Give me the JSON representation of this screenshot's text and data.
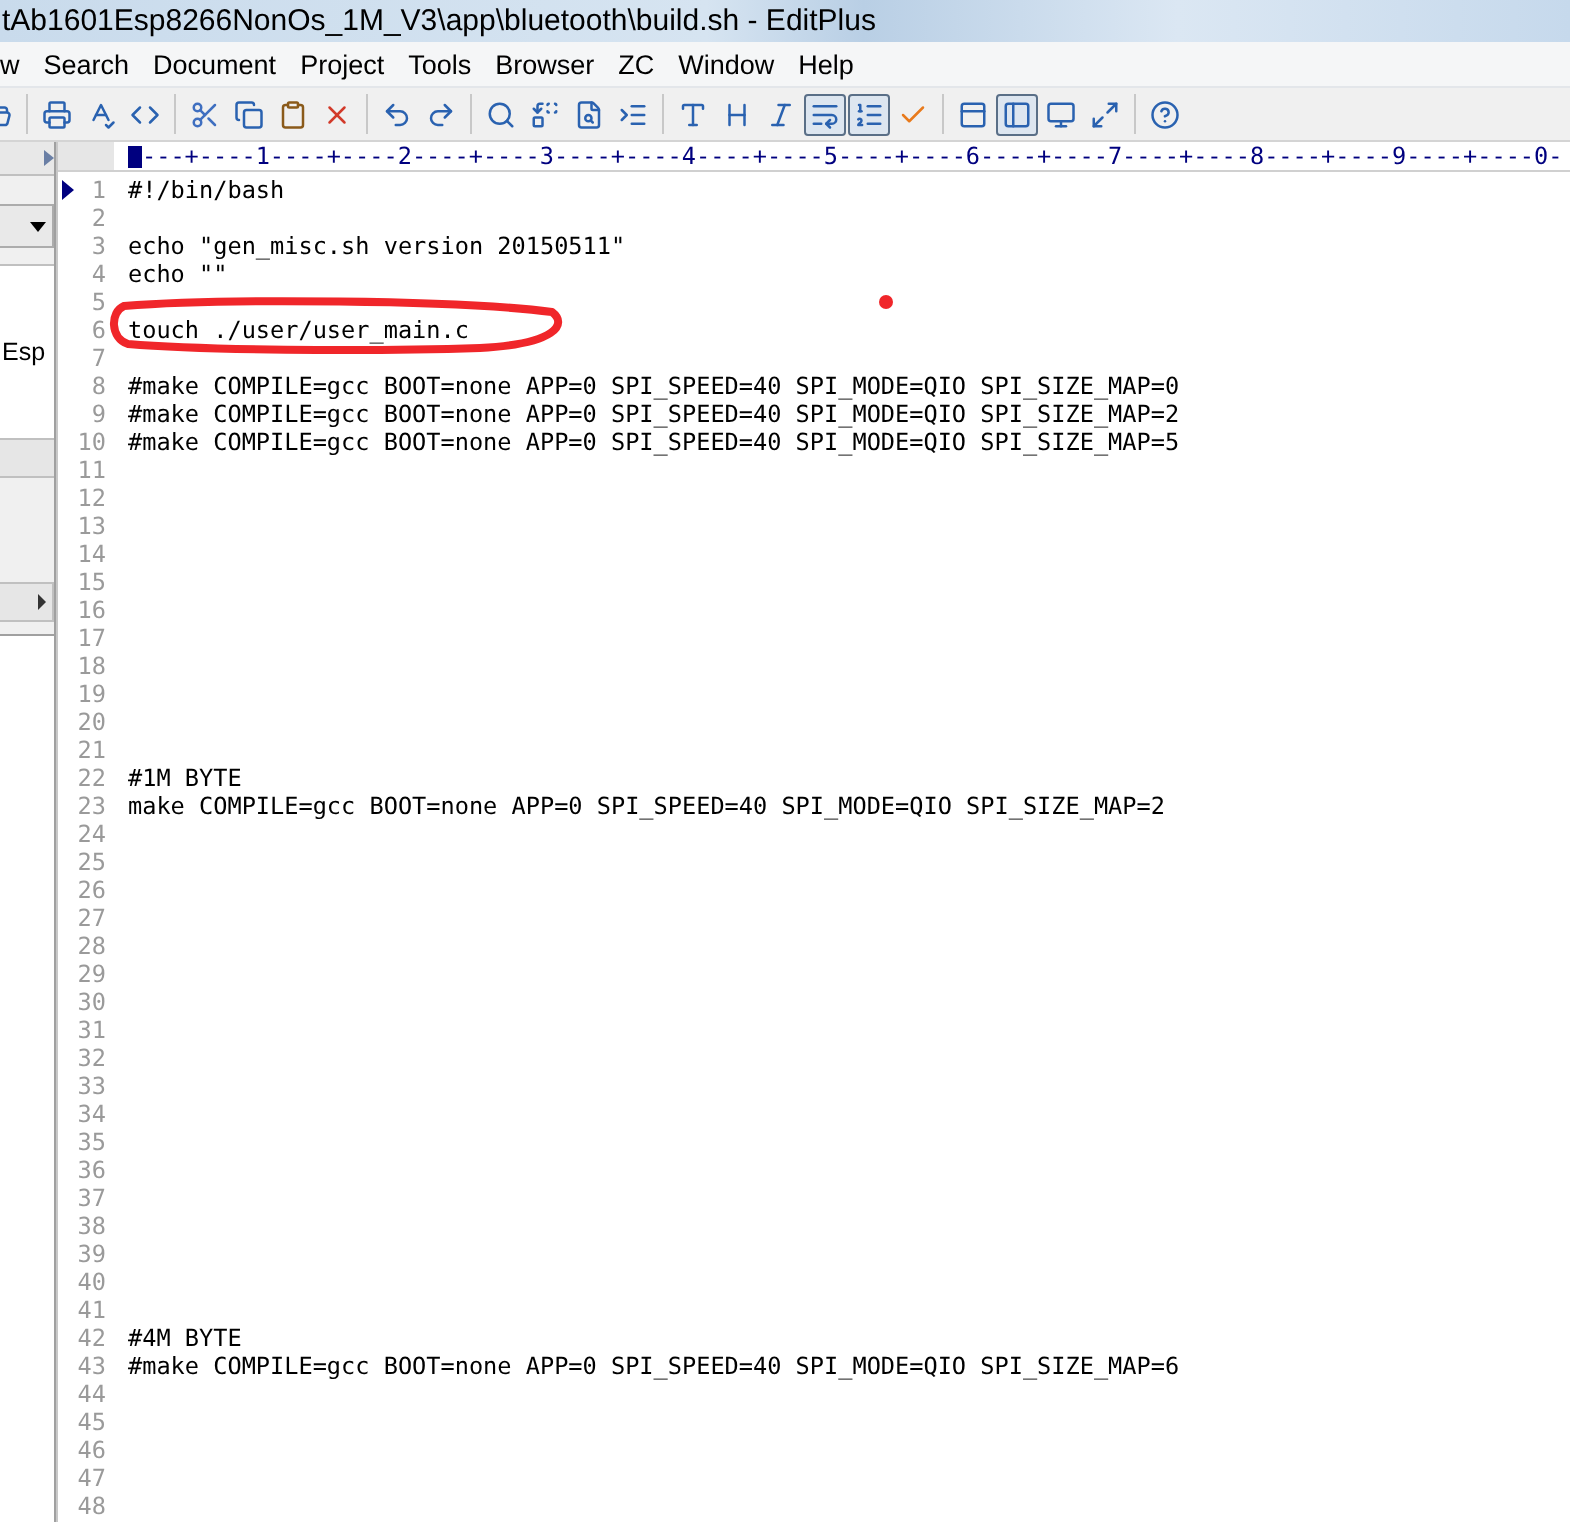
{
  "window": {
    "title": "tAb1601Esp8266NonOs_1M_V3\\app\\bluetooth\\build.sh - EditPlus"
  },
  "menu": [
    "w",
    "Search",
    "Document",
    "Project",
    "Tools",
    "Browser",
    "ZC",
    "Window",
    "Help"
  ],
  "toolbar": [
    {
      "kind": "open",
      "pressed": false
    },
    {
      "kind": "sep"
    },
    {
      "kind": "print",
      "pressed": false
    },
    {
      "kind": "spell",
      "pressed": false
    },
    {
      "kind": "browser",
      "pressed": false
    },
    {
      "kind": "sep"
    },
    {
      "kind": "cut",
      "pressed": false
    },
    {
      "kind": "copy",
      "pressed": false
    },
    {
      "kind": "paste",
      "pressed": false
    },
    {
      "kind": "delete",
      "pressed": false
    },
    {
      "kind": "sep"
    },
    {
      "kind": "undo",
      "pressed": false
    },
    {
      "kind": "redo",
      "pressed": false
    },
    {
      "kind": "sep"
    },
    {
      "kind": "find",
      "pressed": false
    },
    {
      "kind": "replace",
      "pressed": false
    },
    {
      "kind": "findfiles",
      "pressed": false
    },
    {
      "kind": "goto",
      "pressed": false
    },
    {
      "kind": "sep"
    },
    {
      "kind": "font",
      "pressed": false
    },
    {
      "kind": "hex",
      "pressed": false
    },
    {
      "kind": "wordfont",
      "pressed": false
    },
    {
      "kind": "wrap",
      "pressed": true
    },
    {
      "kind": "linenumbers",
      "pressed": true
    },
    {
      "kind": "check",
      "pressed": false
    },
    {
      "kind": "sep"
    },
    {
      "kind": "cliptext",
      "pressed": false
    },
    {
      "kind": "directory",
      "pressed": true
    },
    {
      "kind": "output",
      "pressed": false
    },
    {
      "kind": "fullscreen",
      "pressed": false
    },
    {
      "kind": "sep"
    },
    {
      "kind": "help",
      "pressed": false
    }
  ],
  "sidebar": {
    "label": "Esp"
  },
  "ruler": "---+----1----+----2----+----3----+----4----+----5----+----6----+----7----+----8----+----9----+----0-",
  "lines": [
    {
      "number": "1",
      "text": "#!/bin/bash",
      "current": true
    },
    {
      "number": "2",
      "current": false
    },
    {
      "number": "3",
      "text": "echo \"gen_misc.sh version 20150511\"",
      "current": false
    },
    {
      "number": "4",
      "text": "echo \"\"",
      "current": false
    },
    {
      "number": "5",
      "current": false
    },
    {
      "number": "6",
      "text": "touch ./user/user_main.c",
      "current": false
    },
    {
      "number": "7",
      "current": false
    },
    {
      "number": "8",
      "text": "#make COMPILE=gcc BOOT=none APP=0 SPI_SPEED=40 SPI_MODE=QIO SPI_SIZE_MAP=0",
      "current": false
    },
    {
      "number": "9",
      "text": "#make COMPILE=gcc BOOT=none APP=0 SPI_SPEED=40 SPI_MODE=QIO SPI_SIZE_MAP=2",
      "current": false
    },
    {
      "number": "10",
      "text": "#make COMPILE=gcc BOOT=none APP=0 SPI_SPEED=40 SPI_MODE=QIO SPI_SIZE_MAP=5",
      "current": false
    },
    {
      "number": "11",
      "current": false
    },
    {
      "number": "12",
      "current": false
    },
    {
      "number": "13",
      "current": false
    },
    {
      "number": "14",
      "current": false
    },
    {
      "number": "15",
      "current": false
    },
    {
      "number": "16",
      "current": false
    },
    {
      "number": "17",
      "current": false
    },
    {
      "number": "18",
      "current": false
    },
    {
      "number": "19",
      "current": false
    },
    {
      "number": "20",
      "current": false
    },
    {
      "number": "21",
      "current": false
    },
    {
      "number": "22",
      "text": "#1M BYTE",
      "current": false
    },
    {
      "number": "23",
      "text": "make COMPILE=gcc BOOT=none APP=0 SPI_SPEED=40 SPI_MODE=QIO SPI_SIZE_MAP=2",
      "current": false
    },
    {
      "number": "24",
      "current": false
    },
    {
      "number": "25",
      "current": false
    },
    {
      "number": "26",
      "current": false
    },
    {
      "number": "27",
      "current": false
    },
    {
      "number": "28",
      "current": false
    },
    {
      "number": "29",
      "current": false
    },
    {
      "number": "30",
      "current": false
    },
    {
      "number": "31",
      "current": false
    },
    {
      "number": "32",
      "current": false
    },
    {
      "number": "33",
      "current": false
    },
    {
      "number": "34",
      "current": false
    },
    {
      "number": "35",
      "current": false
    },
    {
      "number": "36",
      "current": false
    },
    {
      "number": "37",
      "current": false
    },
    {
      "number": "38",
      "current": false
    },
    {
      "number": "39",
      "current": false
    },
    {
      "number": "40",
      "current": false
    },
    {
      "number": "41",
      "current": false
    },
    {
      "number": "42",
      "text": "#4M BYTE",
      "current": false
    },
    {
      "number": "43",
      "text": "#make COMPILE=gcc BOOT=none APP=0 SPI_SPEED=40 SPI_MODE=QIO SPI_SIZE_MAP=6",
      "current": false
    },
    {
      "number": "44",
      "current": false
    },
    {
      "number": "45",
      "current": false
    },
    {
      "number": "46",
      "current": false
    },
    {
      "number": "47",
      "current": false
    },
    {
      "number": "48",
      "current": false
    }
  ]
}
